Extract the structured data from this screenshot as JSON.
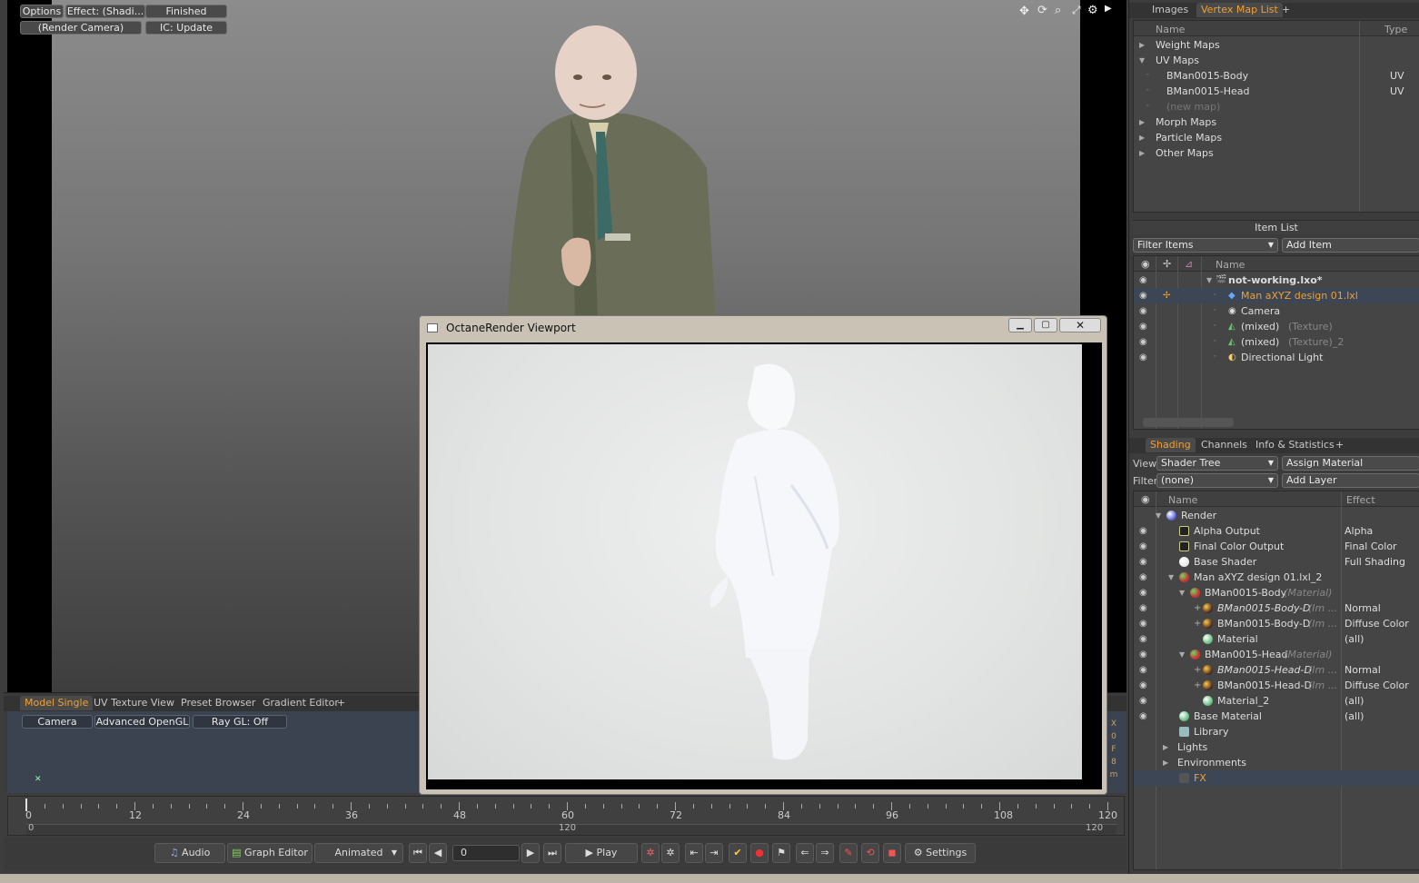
{
  "viewport": {
    "options_label": "Options",
    "effect_label": "Effect: (Shadi...",
    "status_label": "Finished",
    "camera_label": "(Render Camera)",
    "ic_label": "IC: Update"
  },
  "octane": {
    "title": "OctaneRender Viewport"
  },
  "bottom_tabs": {
    "tabs": [
      "Model Single",
      "UV Texture View",
      "Preset Browser",
      "Gradient Editor",
      "+"
    ],
    "buttons": [
      "Camera",
      "Advanced OpenGL",
      "Ray GL: Off"
    ]
  },
  "timeline": {
    "major_labels": [
      "0",
      "12",
      "24",
      "36",
      "48",
      "60",
      "72",
      "84",
      "96",
      "108",
      "120"
    ],
    "range_start": "0",
    "range_mid": "120",
    "range_end": "120"
  },
  "transport": {
    "audio": "Audio",
    "graph_editor": "Graph Editor",
    "animated": "Animated",
    "frame": "0",
    "play": "Play",
    "settings": "Settings"
  },
  "vertex_panel": {
    "tabs": [
      "Images",
      "Vertex Map List",
      "+"
    ],
    "col_name": "Name",
    "col_type": "Type",
    "rows": [
      {
        "label": "Weight Maps",
        "type": ""
      },
      {
        "label": "UV Maps",
        "type": ""
      },
      {
        "label": "BMan0015-Body",
        "type": "UV"
      },
      {
        "label": "BMan0015-Head",
        "type": "UV"
      },
      {
        "label": "(new map)",
        "type": ""
      },
      {
        "label": "Morph Maps",
        "type": ""
      },
      {
        "label": "Particle Maps",
        "type": ""
      },
      {
        "label": "Other Maps",
        "type": ""
      }
    ]
  },
  "item_list": {
    "title": "Item List",
    "filter": "Filter Items",
    "add": "Add Item",
    "col_name": "Name",
    "rows": [
      {
        "label": "not-working.lxo*",
        "sub": ""
      },
      {
        "label": "Man aXYZ design 01.lxl",
        "sub": ""
      },
      {
        "label": "Camera",
        "sub": ""
      },
      {
        "label": "(mixed)",
        "sub": "(Texture)"
      },
      {
        "label": "(mixed)",
        "sub": "(Texture)_2"
      },
      {
        "label": "Directional Light",
        "sub": ""
      }
    ]
  },
  "shading": {
    "tabs": [
      "Shading",
      "Channels",
      "Info & Statistics",
      "+"
    ],
    "view_label": "View",
    "view_value": "Shader Tree",
    "assign": "Assign Material",
    "filter_label": "Filter",
    "filter_value": "(none)",
    "add_layer": "Add Layer",
    "col_name": "Name",
    "col_effect": "Effect",
    "rows": [
      {
        "label": "Render",
        "sub": "",
        "effect": ""
      },
      {
        "label": "Alpha Output",
        "sub": "",
        "effect": "Alpha"
      },
      {
        "label": "Final Color Output",
        "sub": "",
        "effect": "Final Color"
      },
      {
        "label": "Base Shader",
        "sub": "",
        "effect": "Full Shading"
      },
      {
        "label": "Man aXYZ design 01.lxl_2",
        "sub": "",
        "effect": ""
      },
      {
        "label": "BMan0015-Body",
        "sub": "(Material)",
        "effect": ""
      },
      {
        "label": "BMan0015-Body-D",
        "sub": "(Im ...",
        "effect": "Normal"
      },
      {
        "label": "BMan0015-Body-D",
        "sub": "(Im ...",
        "effect": "Diffuse Color"
      },
      {
        "label": "Material",
        "sub": "",
        "effect": "(all)"
      },
      {
        "label": "BMan0015-Head",
        "sub": "(Material)",
        "effect": ""
      },
      {
        "label": "BMan0015-Head-D",
        "sub": "(Im ...",
        "effect": "Normal"
      },
      {
        "label": "BMan0015-Head-D",
        "sub": "(Im ...",
        "effect": "Diffuse Color"
      },
      {
        "label": "Material_2",
        "sub": "",
        "effect": "(all)"
      },
      {
        "label": "Base Material",
        "sub": "",
        "effect": "(all)"
      },
      {
        "label": "Library",
        "sub": "",
        "effect": ""
      },
      {
        "label": "Lights",
        "sub": "",
        "effect": ""
      },
      {
        "label": "Environments",
        "sub": "",
        "effect": ""
      },
      {
        "label": "FX",
        "sub": "",
        "effect": ""
      }
    ]
  },
  "side_strip": {
    "chars": [
      "X",
      "0",
      "F",
      "8",
      "m"
    ]
  },
  "colors": {
    "accent": "#f0a030",
    "selected_row": "#3c4654"
  }
}
